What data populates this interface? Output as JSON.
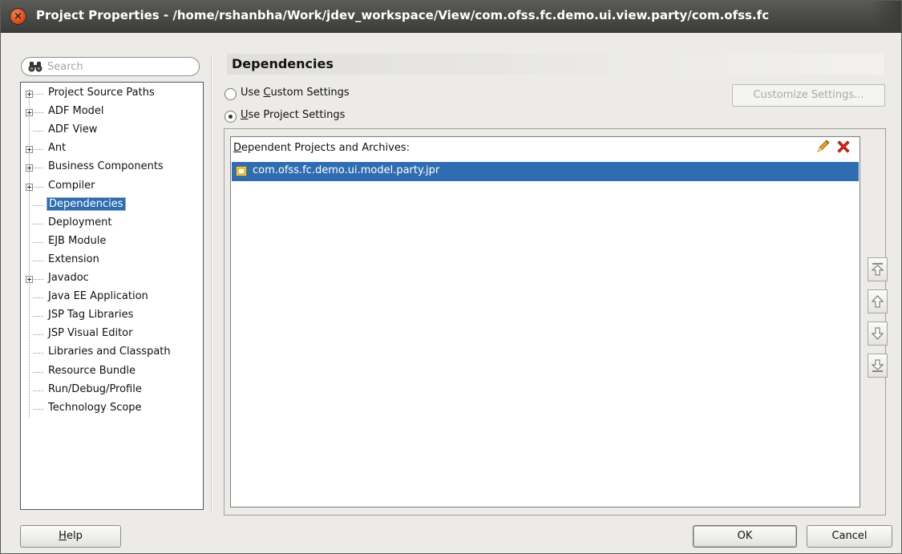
{
  "window": {
    "title": "Project Properties - /home/rshanbha/Work/jdev_workspace/View/com.ofss.fc.demo.ui.view.party/com.ofss.fc"
  },
  "search": {
    "placeholder": "Search"
  },
  "tree": {
    "items": [
      {
        "label": "Project Source Paths",
        "expandable": true,
        "selected": false
      },
      {
        "label": "ADF Model",
        "expandable": true,
        "selected": false
      },
      {
        "label": "ADF View",
        "expandable": false,
        "selected": false
      },
      {
        "label": "Ant",
        "expandable": true,
        "selected": false
      },
      {
        "label": "Business Components",
        "expandable": true,
        "selected": false
      },
      {
        "label": "Compiler",
        "expandable": true,
        "selected": false
      },
      {
        "label": "Dependencies",
        "expandable": false,
        "selected": true
      },
      {
        "label": "Deployment",
        "expandable": false,
        "selected": false
      },
      {
        "label": "EJB Module",
        "expandable": false,
        "selected": false
      },
      {
        "label": "Extension",
        "expandable": false,
        "selected": false
      },
      {
        "label": "Javadoc",
        "expandable": true,
        "selected": false
      },
      {
        "label": "Java EE Application",
        "expandable": false,
        "selected": false
      },
      {
        "label": "JSP Tag Libraries",
        "expandable": false,
        "selected": false
      },
      {
        "label": "JSP Visual Editor",
        "expandable": false,
        "selected": false
      },
      {
        "label": "Libraries and Classpath",
        "expandable": false,
        "selected": false
      },
      {
        "label": "Resource Bundle",
        "expandable": false,
        "selected": false
      },
      {
        "label": "Run/Debug/Profile",
        "expandable": false,
        "selected": false
      },
      {
        "label": "Technology Scope",
        "expandable": false,
        "selected": false
      }
    ]
  },
  "main": {
    "title": "Dependencies",
    "radio_custom": {
      "prefix": "Use ",
      "mnemonic": "C",
      "rest": "ustom Settings",
      "checked": false
    },
    "radio_project": {
      "prefix": "",
      "mnemonic": "U",
      "rest": "se Project Settings",
      "checked": true
    },
    "customize_button": "Customize Settings...",
    "dependents": {
      "header_mnemonic": "D",
      "header_rest": "ependent Projects and Archives:",
      "items": [
        {
          "label": "com.ofss.fc.demo.ui.model.party.jpr",
          "selected": true
        }
      ]
    }
  },
  "footer": {
    "help_mnemonic": "H",
    "help_rest": "elp",
    "ok": "OK",
    "cancel": "Cancel"
  },
  "colors": {
    "selection": "#2f6db0",
    "titlebar": "#3b3b39",
    "close_button": "#dc4a1c",
    "delete_icon": "#d42a1a",
    "edit_icon": "#d98f1e"
  }
}
